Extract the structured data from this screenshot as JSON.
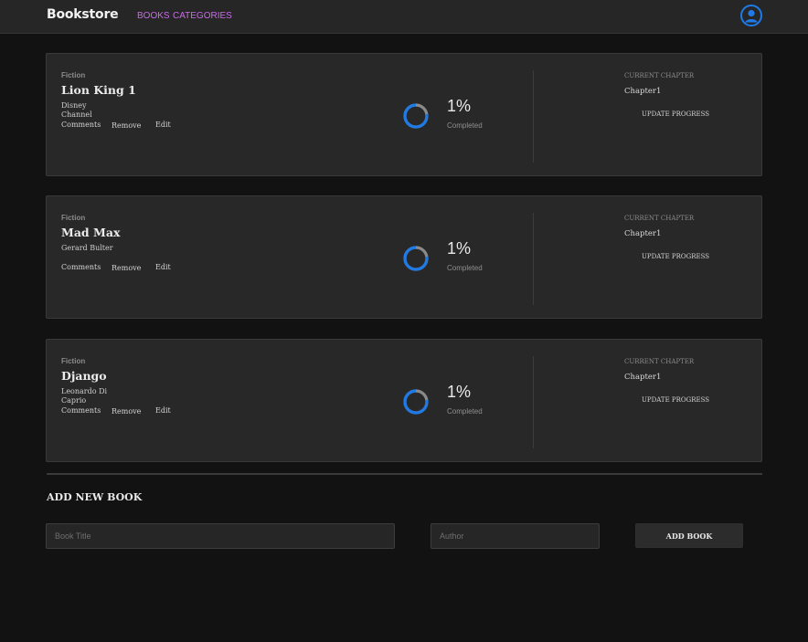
{
  "nav": {
    "brand": "Bookstore",
    "links": [
      "BOOKS",
      "CATEGORIES"
    ]
  },
  "user_icon": "user-avatar-icon",
  "books": [
    {
      "genre": "Fiction",
      "title": "Lion King 1",
      "author": "Disney Channel",
      "actions": [
        "Comments",
        "Remove",
        "Edit"
      ],
      "progress_percent": "1%",
      "progress_value": 1,
      "progress_label": "Completed",
      "current_chapter_label": "CURRENT CHAPTER",
      "current_chapter": "Chapter1",
      "update_label": "UPDATE PROGRESS"
    },
    {
      "genre": "Fiction",
      "title": "Mad Max",
      "author": "Gerard Bulter",
      "actions": [
        "Comments",
        "Remove",
        "Edit"
      ],
      "progress_percent": "1%",
      "progress_value": 1,
      "progress_label": "Completed",
      "current_chapter_label": "CURRENT CHAPTER",
      "current_chapter": "Chapter1",
      "update_label": "UPDATE PROGRESS"
    },
    {
      "genre": "Fiction",
      "title": "Django",
      "author": "Leonardo Di Caprio",
      "actions": [
        "Comments",
        "Remove",
        "Edit"
      ],
      "progress_percent": "1%",
      "progress_value": 1,
      "progress_label": "Completed",
      "current_chapter_label": "CURRENT CHAPTER",
      "current_chapter": "Chapter1",
      "update_label": "UPDATE PROGRESS"
    }
  ],
  "form": {
    "title": "ADD NEW BOOK",
    "title_placeholder": "Book Title",
    "author_placeholder": "Author",
    "submit_label": "ADD BOOK"
  },
  "colors": {
    "accent_blue": "#1e7ae6",
    "nav_link": "#c86be8",
    "ring_track": "#8a8a8a"
  }
}
